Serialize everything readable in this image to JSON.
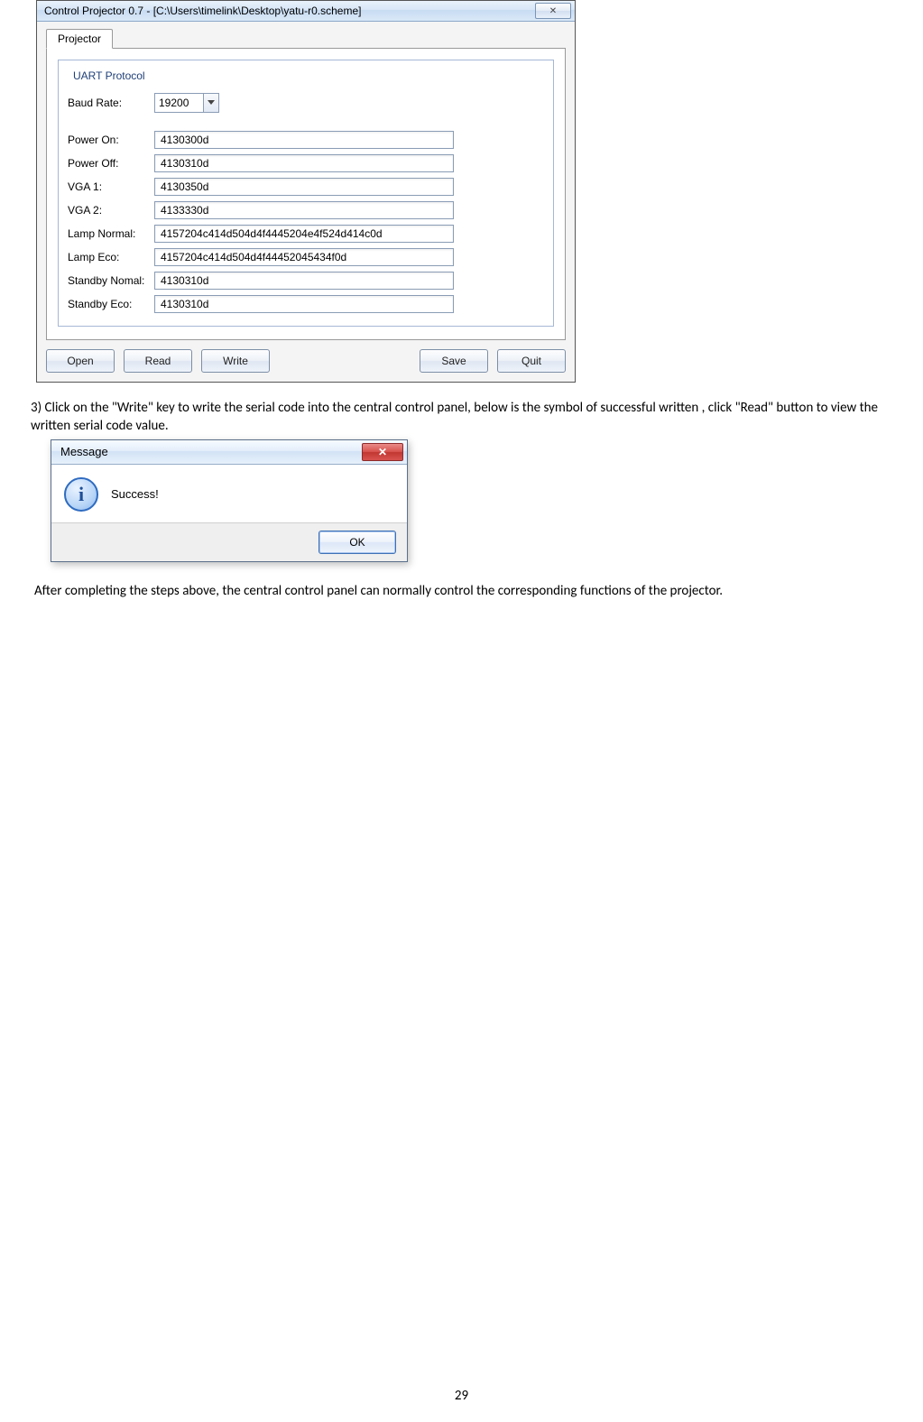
{
  "app": {
    "title": "Control Projector 0.7 - [C:\\Users\\timelink\\Desktop\\yatu-r0.scheme]",
    "close_glyph": "✕",
    "tab_label": "Projector",
    "group_title": "UART Protocol",
    "baud_label": "Baud Rate:",
    "baud_value": "19200",
    "fields": [
      {
        "label": "Power On:",
        "value": "4130300d"
      },
      {
        "label": "Power Off:",
        "value": "4130310d"
      },
      {
        "label": "VGA 1:",
        "value": "4130350d"
      },
      {
        "label": "VGA 2:",
        "value": "4133330d"
      },
      {
        "label": "Lamp Normal:",
        "value": "4157204c414d504d4f4445204e4f524d414c0d"
      },
      {
        "label": "Lamp Eco:",
        "value": "4157204c414d504d4f44452045434f0d"
      },
      {
        "label": "Standby Nomal:",
        "value": "4130310d"
      },
      {
        "label": "Standby Eco:",
        "value": "4130310d"
      }
    ],
    "buttons": {
      "open": "Open",
      "read": "Read",
      "write": "Write",
      "save": "Save",
      "quit": "Quit"
    }
  },
  "doc": {
    "step3": "3) Click on the \"Write\" key to write the serial code into the central control panel, below is the symbol of successful written , click \"Read\" button to view the written serial code value.",
    "after": "After completing the steps above, the central control panel can normally control the corresponding functions of the projector.",
    "page_number": "29"
  },
  "msg": {
    "title": "Message",
    "close_glyph": "✕",
    "info_glyph": "i",
    "text": "Success!",
    "ok": "OK"
  }
}
